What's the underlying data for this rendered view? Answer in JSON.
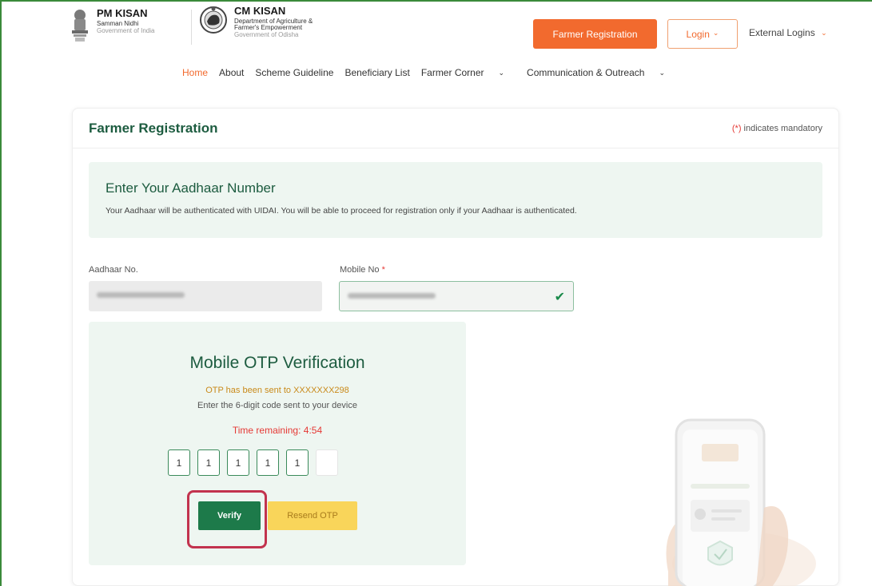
{
  "header": {
    "pm_kisan": {
      "title": "PM KISAN",
      "subtitle": "Samman Nidhi",
      "org": "Government of India"
    },
    "cm_kisan": {
      "title": "CM KISAN",
      "subtitle": "Department of Agriculture & Farmer's Empowerment",
      "org": "Government of Odisha"
    },
    "farmer_registration_label": "Farmer Registration",
    "login_label": "Login",
    "external_logins_label": "External Logins"
  },
  "nav": {
    "items": [
      {
        "label": "Home",
        "active": true
      },
      {
        "label": "About"
      },
      {
        "label": "Scheme Guideline"
      },
      {
        "label": "Beneficiary List"
      },
      {
        "label": "Farmer Corner",
        "dropdown": true
      },
      {
        "label": "Communication & Outreach",
        "dropdown": true
      }
    ]
  },
  "card": {
    "title": "Farmer Registration",
    "mandatory_marker": "(*)",
    "mandatory_text": "indicates mandatory"
  },
  "aadhaar_section": {
    "heading": "Enter Your Aadhaar Number",
    "description": "Your Aadhaar will be authenticated with UIDAI. You will be able to proceed for registration only if your Aadhaar is authenticated."
  },
  "form": {
    "aadhaar_label": "Aadhaar No.",
    "mobile_label": "Mobile No",
    "mobile_required_marker": "*"
  },
  "otp": {
    "title": "Mobile OTP Verification",
    "sent_message": "OTP has been sent to XXXXXXX298",
    "instruction": "Enter the 6-digit code sent to your device",
    "timer_text": "Time remaining: 4:54",
    "digits": [
      "1",
      "1",
      "1",
      "1",
      "1",
      ""
    ],
    "verify_label": "Verify",
    "resend_label": "Resend OTP"
  },
  "colors": {
    "brand_orange": "#f26a2e",
    "brand_green": "#1d5c40",
    "verify_green": "#1d7a4a",
    "resend_yellow": "#f9d55a",
    "alert_red": "#e53935",
    "highlight_border": "#c2334e"
  }
}
